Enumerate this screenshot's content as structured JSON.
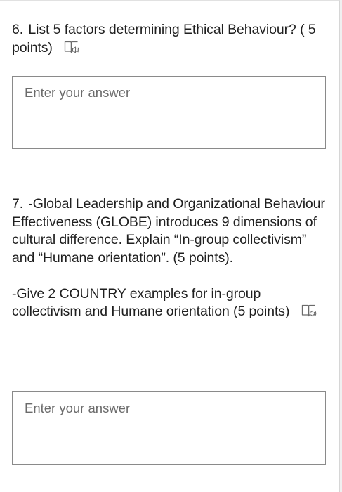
{
  "questions": [
    {
      "number": "6.",
      "text": "List 5 factors determining Ethical Behaviour? ( 5 points)",
      "speaker_icon": "immersive-reader-icon",
      "answer_placeholder": "Enter your answer"
    },
    {
      "number": "7.",
      "text_part1": "-Global Leadership and Organizational Behaviour Effectiveness (GLOBE) introduces 9 dimensions of cultural difference. Explain “In-group collectivism” and “Humane orientation”. (5 points).",
      "text_part2": "-Give 2 COUNTRY examples for in-group collectivism and Humane orientation (5 points)",
      "speaker_icon": "immersive-reader-icon",
      "answer_placeholder": "Enter your answer"
    }
  ]
}
